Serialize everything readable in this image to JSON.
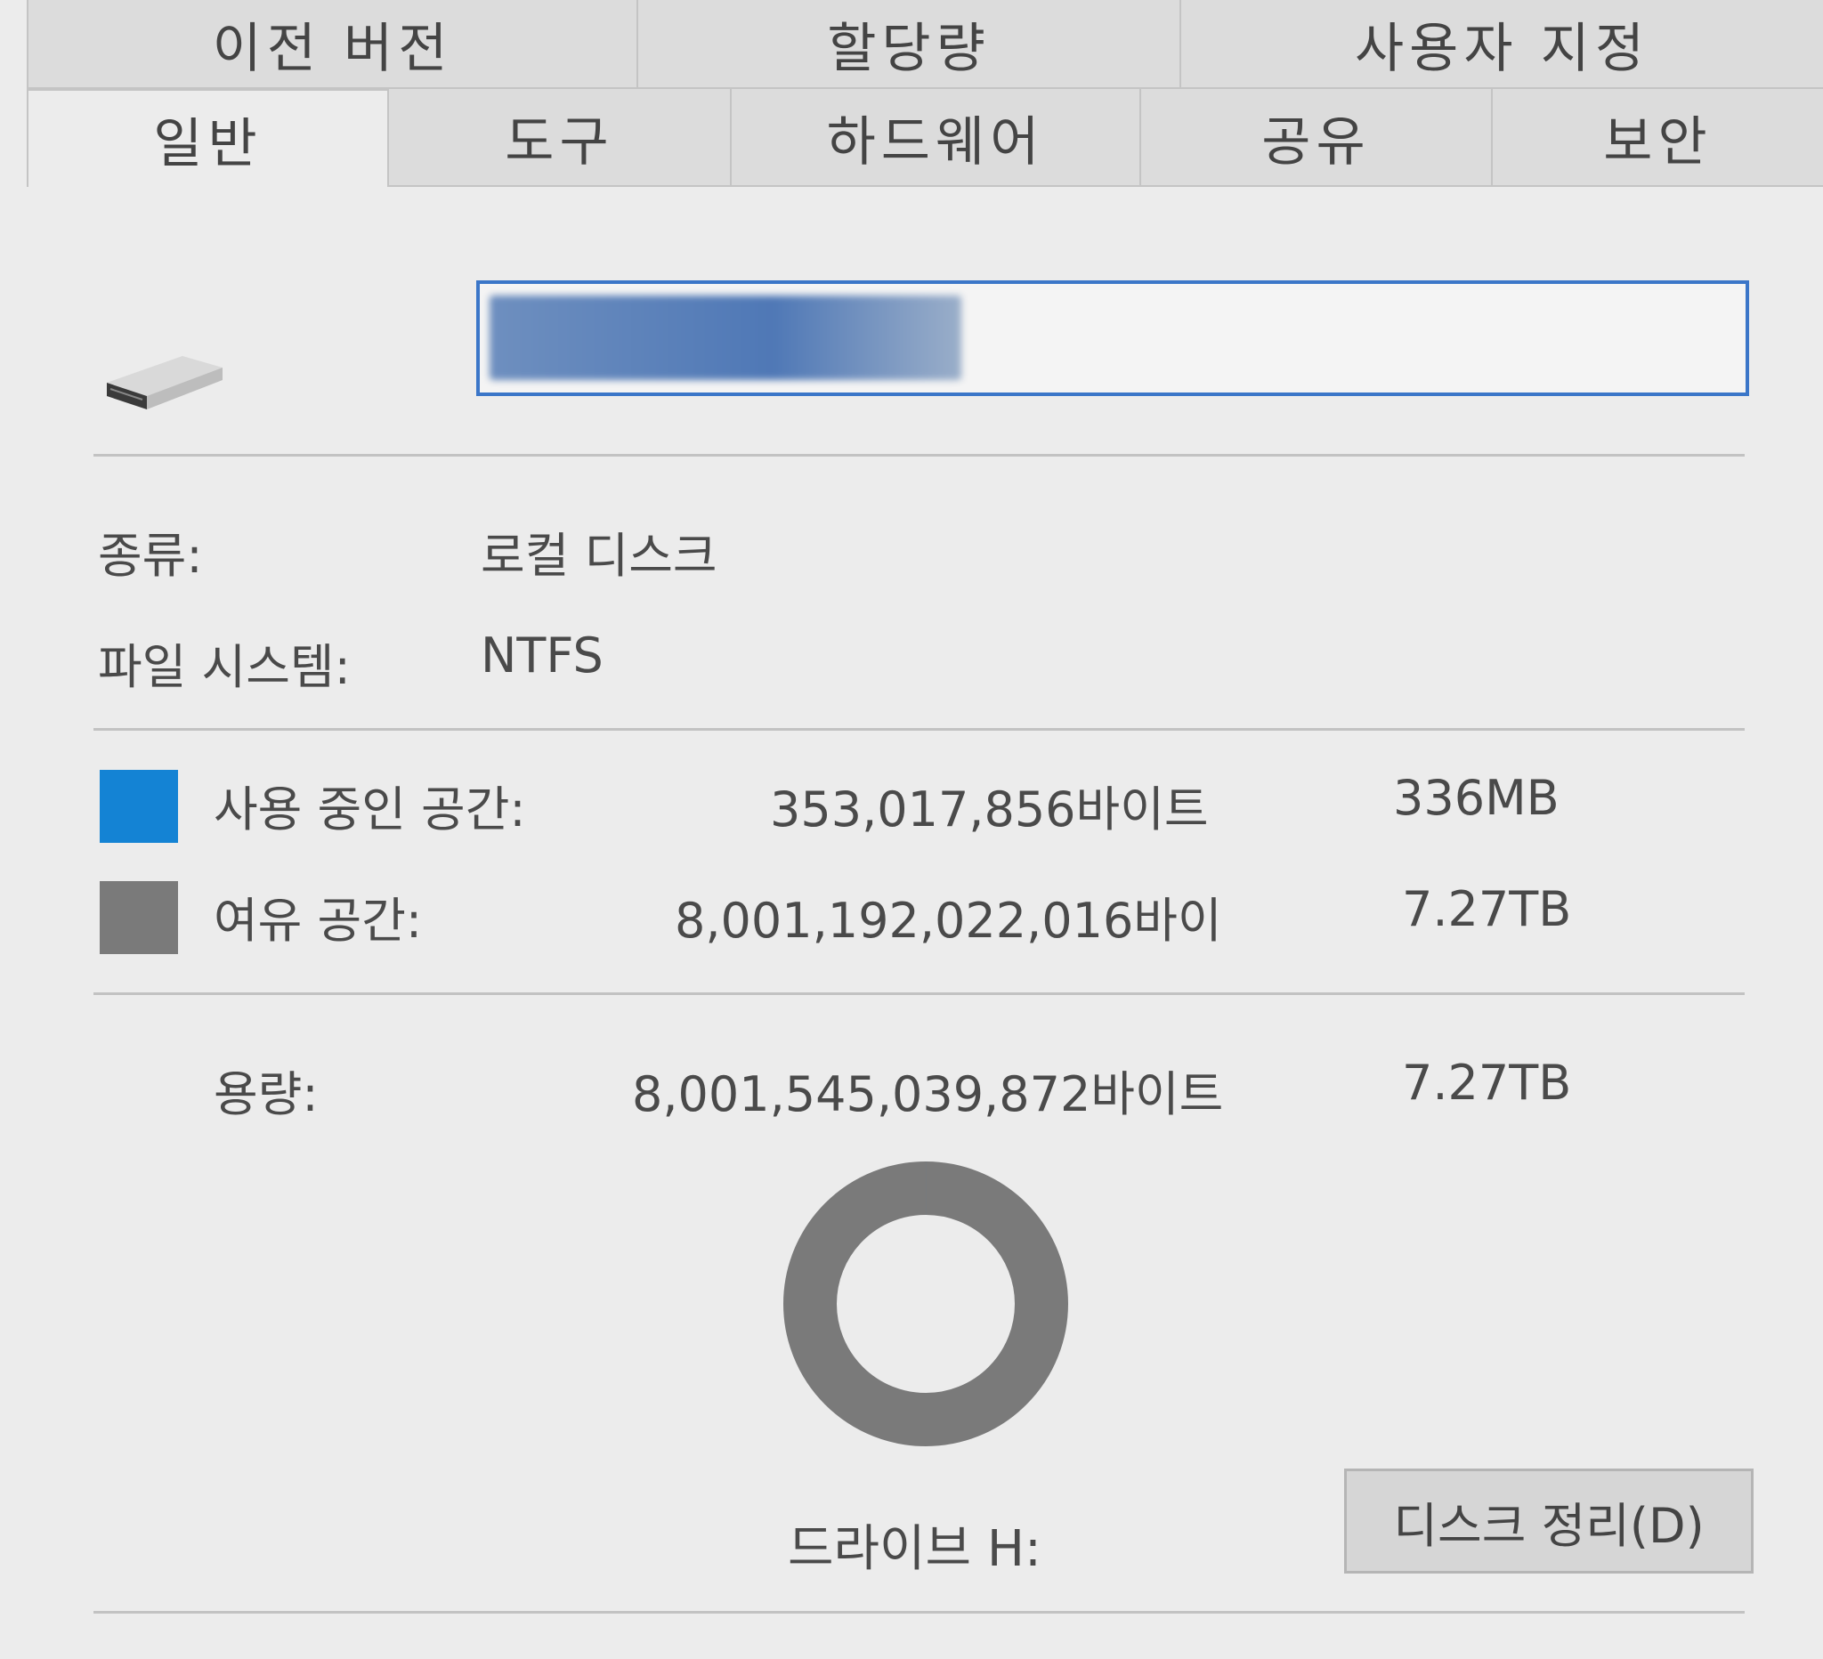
{
  "tabs_top": [
    {
      "label": "이전 버전"
    },
    {
      "label": "할당량"
    },
    {
      "label": "사용자 지정"
    }
  ],
  "tabs_bottom": [
    {
      "label": "일반",
      "active": true
    },
    {
      "label": "도구"
    },
    {
      "label": "하드웨어"
    },
    {
      "label": "공유"
    },
    {
      "label": "보안"
    }
  ],
  "general": {
    "drive_name_value": "",
    "type_label": "종류:",
    "type_value": "로컬 디스크",
    "fs_label": "파일 시스템:",
    "fs_value": "NTFS",
    "used_label": "사용 중인 공간:",
    "used_bytes": "353,017,856바이트",
    "used_size": "336MB",
    "free_label": "여유 공간:",
    "free_bytes": "8,001,192,022,016바이",
    "free_size": "7.27TB",
    "capacity_label": "용량:",
    "capacity_bytes": "8,001,545,039,872바이트",
    "capacity_size": "7.27TB",
    "drive_label": "드라이브 H:",
    "cleanup_button": "디스크 정리(D)",
    "used_fraction": 4.41e-05
  },
  "colors": {
    "used": "#1483d4",
    "free": "#7a7a7a",
    "input_border": "#3b76c8"
  },
  "icons": {
    "drive": "drive-icon"
  }
}
